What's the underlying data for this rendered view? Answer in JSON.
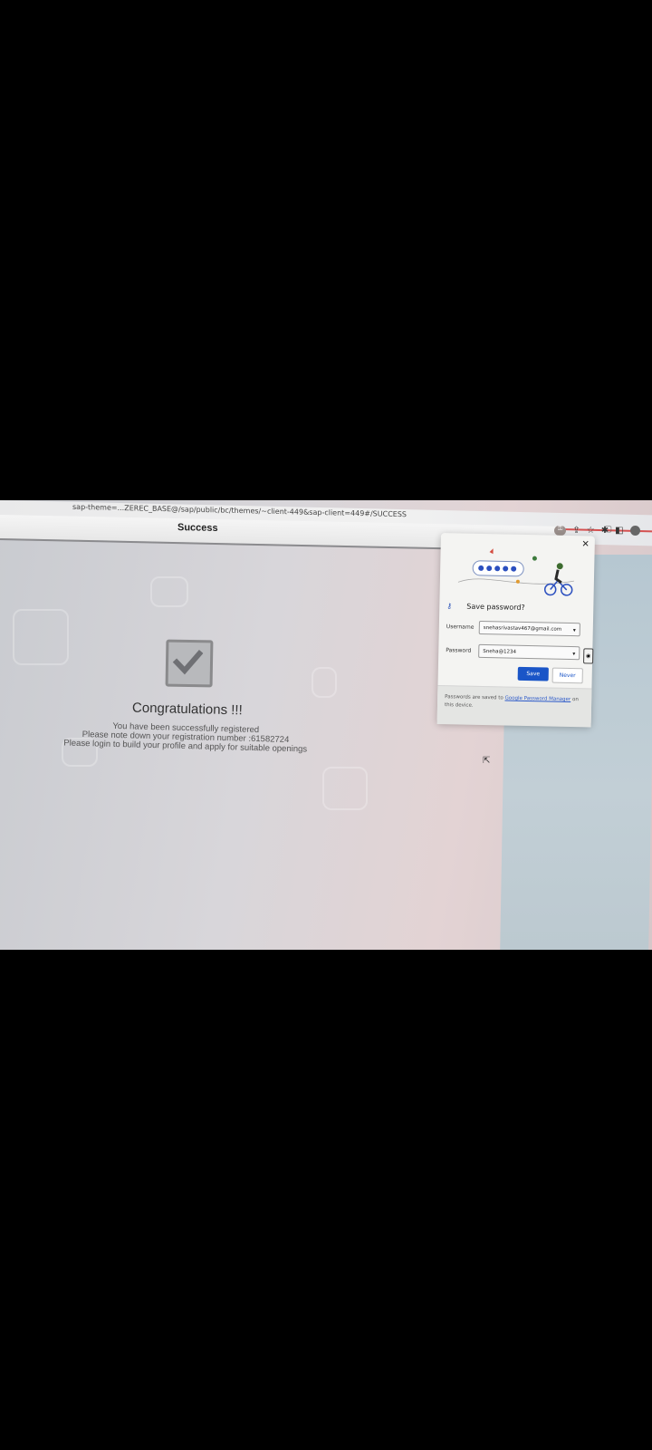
{
  "browser": {
    "url_text": "...ZEREC_BASE@/sap/public/bc/themes/~client-449&sap-client=449#/SUCCESS",
    "url_prefix": "sap-theme=",
    "window_controls": "⌄ – ▢"
  },
  "page": {
    "title": "Success",
    "congrats": "Congratulations !!!",
    "line1": "You have been successfully registered",
    "line2": "Please note down your registration number :61582724",
    "line3": "Please login to build your profile and apply for suitable openings"
  },
  "password_popup": {
    "heading": "Save password?",
    "username_label": "Username",
    "username_value": "snehasrivastav467@gmail.com",
    "password_label": "Password",
    "password_value": "Sneha@1234",
    "save_label": "Save",
    "never_label": "Never",
    "footer_text": "Passwords are saved to",
    "footer_link": "Google Password Manager",
    "footer_suffix": "on this device."
  },
  "colors": {
    "save_button": "#1a55c7",
    "url_underline": "#d45050"
  },
  "icons": [
    "key-icon",
    "share-icon",
    "star-icon",
    "extensions-icon",
    "sidepanel-icon",
    "profile-icon",
    "close-icon",
    "eye-icon",
    "checkmark-icon",
    "cursor-icon"
  ]
}
